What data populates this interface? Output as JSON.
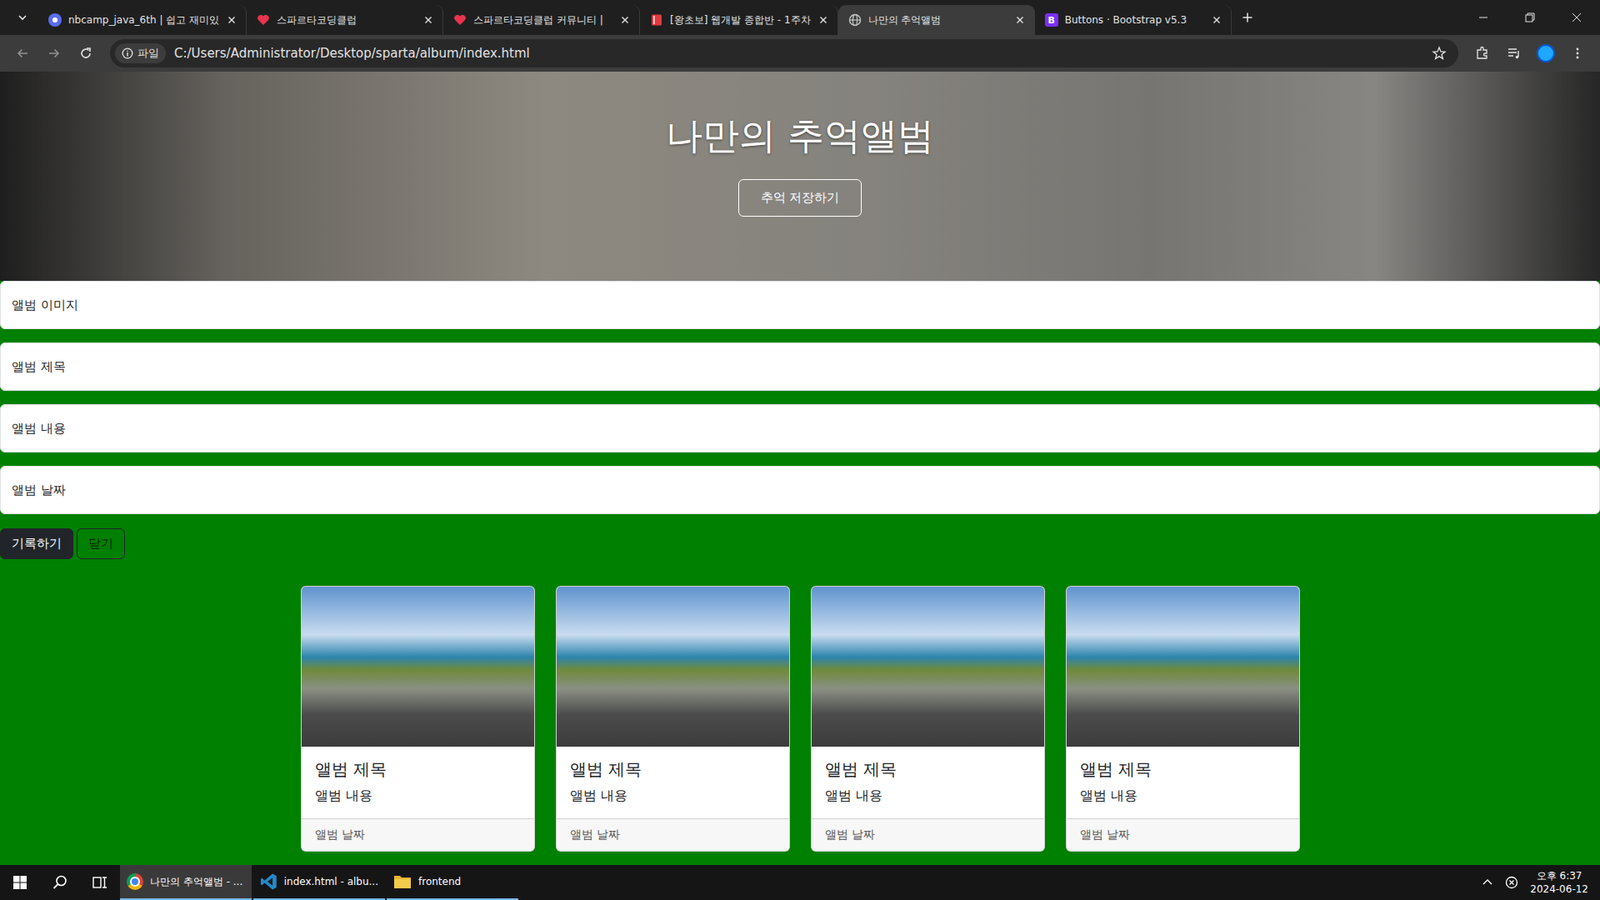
{
  "tabs": [
    {
      "label": "nbcamp_java_6th | 쉽고 재미있",
      "kind": "nbcamp",
      "selected": false
    },
    {
      "label": "스파르타코딩클럽",
      "kind": "sparta",
      "selected": false
    },
    {
      "label": "스파르타코딩클럽 커뮤니티 |",
      "kind": "sparta",
      "selected": false
    },
    {
      "label": "[왕초보] 웹개발 종합반 - 1주차",
      "kind": "book",
      "selected": false
    },
    {
      "label": "나만의 추억앨범",
      "kind": "globe",
      "selected": true
    },
    {
      "label": "Buttons · Bootstrap v5.3",
      "kind": "bootstrap",
      "glyph": "B",
      "selected": false
    }
  ],
  "address_bar": {
    "chip": "파일",
    "url": "C:/Users/Administrator/Desktop/sparta/album/index.html"
  },
  "hero": {
    "title": "나만의 추억앨범",
    "button": "추억 저장하기"
  },
  "form": {
    "fields": [
      "앨범 이미지",
      "앨범 제목",
      "앨범 내용",
      "앨범 날짜"
    ],
    "buttons": [
      {
        "label": "기록하기",
        "kind": "primary"
      },
      {
        "label": "닫기",
        "kind": "outline"
      }
    ]
  },
  "cards": [
    {
      "title": "앨범 제목",
      "text": "앨범 내용",
      "date": "앨범 날짜"
    },
    {
      "title": "앨범 제목",
      "text": "앨범 내용",
      "date": "앨범 날짜"
    },
    {
      "title": "앨범 제목",
      "text": "앨범 내용",
      "date": "앨범 날짜"
    },
    {
      "title": "앨범 제목",
      "text": "앨범 내용",
      "date": "앨범 날짜"
    }
  ],
  "taskbar": {
    "items": [
      {
        "label": "나만의 추억앨범 - ...",
        "kind": "chrome",
        "selected": true
      },
      {
        "label": "index.html - albu...",
        "kind": "vscode",
        "selected": false
      },
      {
        "label": "frontend",
        "kind": "folder",
        "selected": false
      }
    ],
    "time": "오후 6:37",
    "date": "2024-06-12"
  }
}
